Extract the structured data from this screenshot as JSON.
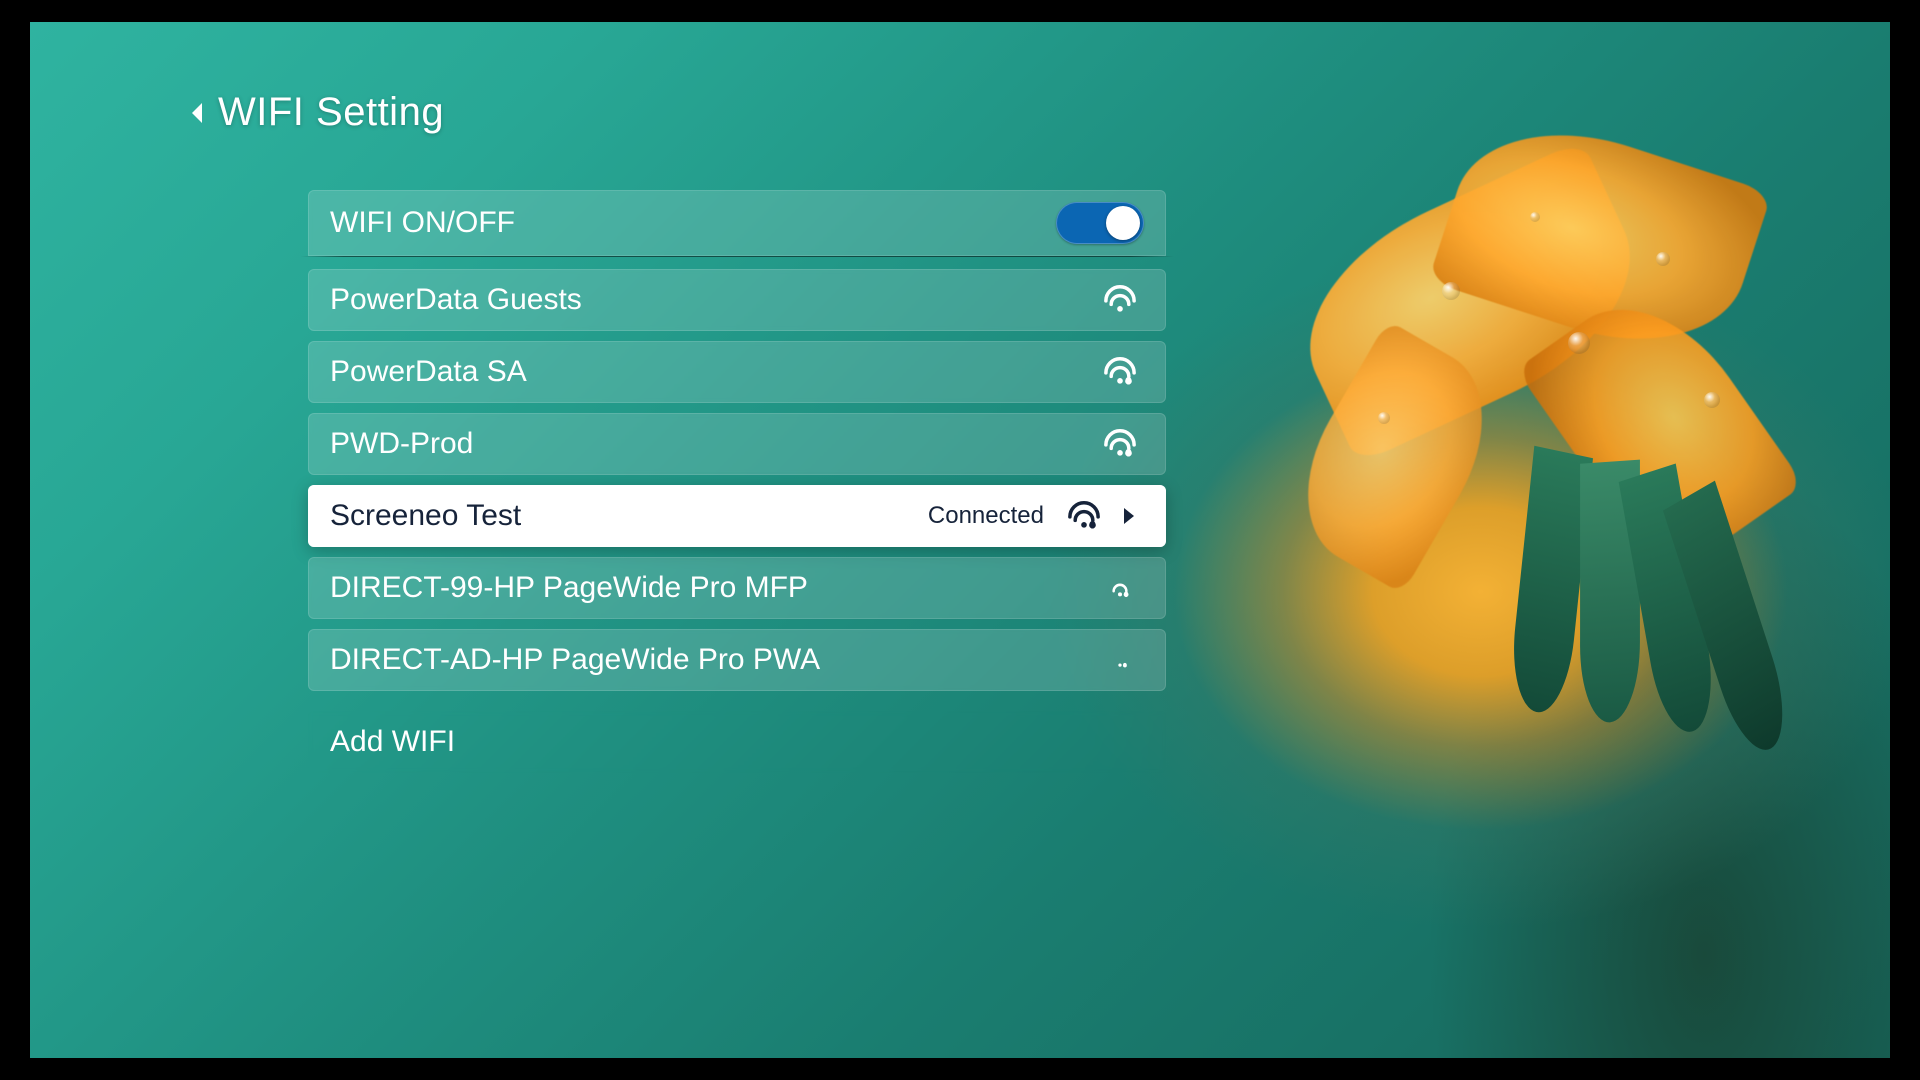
{
  "header": {
    "title": "WIFI Setting"
  },
  "toggle": {
    "label": "WIFI ON/OFF",
    "on": true
  },
  "networks": [
    {
      "ssid": "PowerData Guests",
      "secured": false,
      "signal": "high",
      "status": "",
      "selected": false
    },
    {
      "ssid": "PowerData SA",
      "secured": true,
      "signal": "high",
      "status": "",
      "selected": false
    },
    {
      "ssid": "PWD-Prod",
      "secured": true,
      "signal": "high",
      "status": "",
      "selected": false
    },
    {
      "ssid": "Screeneo Test",
      "secured": true,
      "signal": "high",
      "status": "Connected",
      "selected": true
    },
    {
      "ssid": "DIRECT-99-HP PageWide Pro MFP",
      "secured": true,
      "signal": "medium",
      "status": "",
      "selected": false
    },
    {
      "ssid": "DIRECT-AD-HP PageWide Pro PWA",
      "secured": true,
      "signal": "low",
      "status": "",
      "selected": false
    }
  ],
  "addWifi": {
    "label": "Add WIFI"
  },
  "colors": {
    "accent": "#0b66b3"
  }
}
